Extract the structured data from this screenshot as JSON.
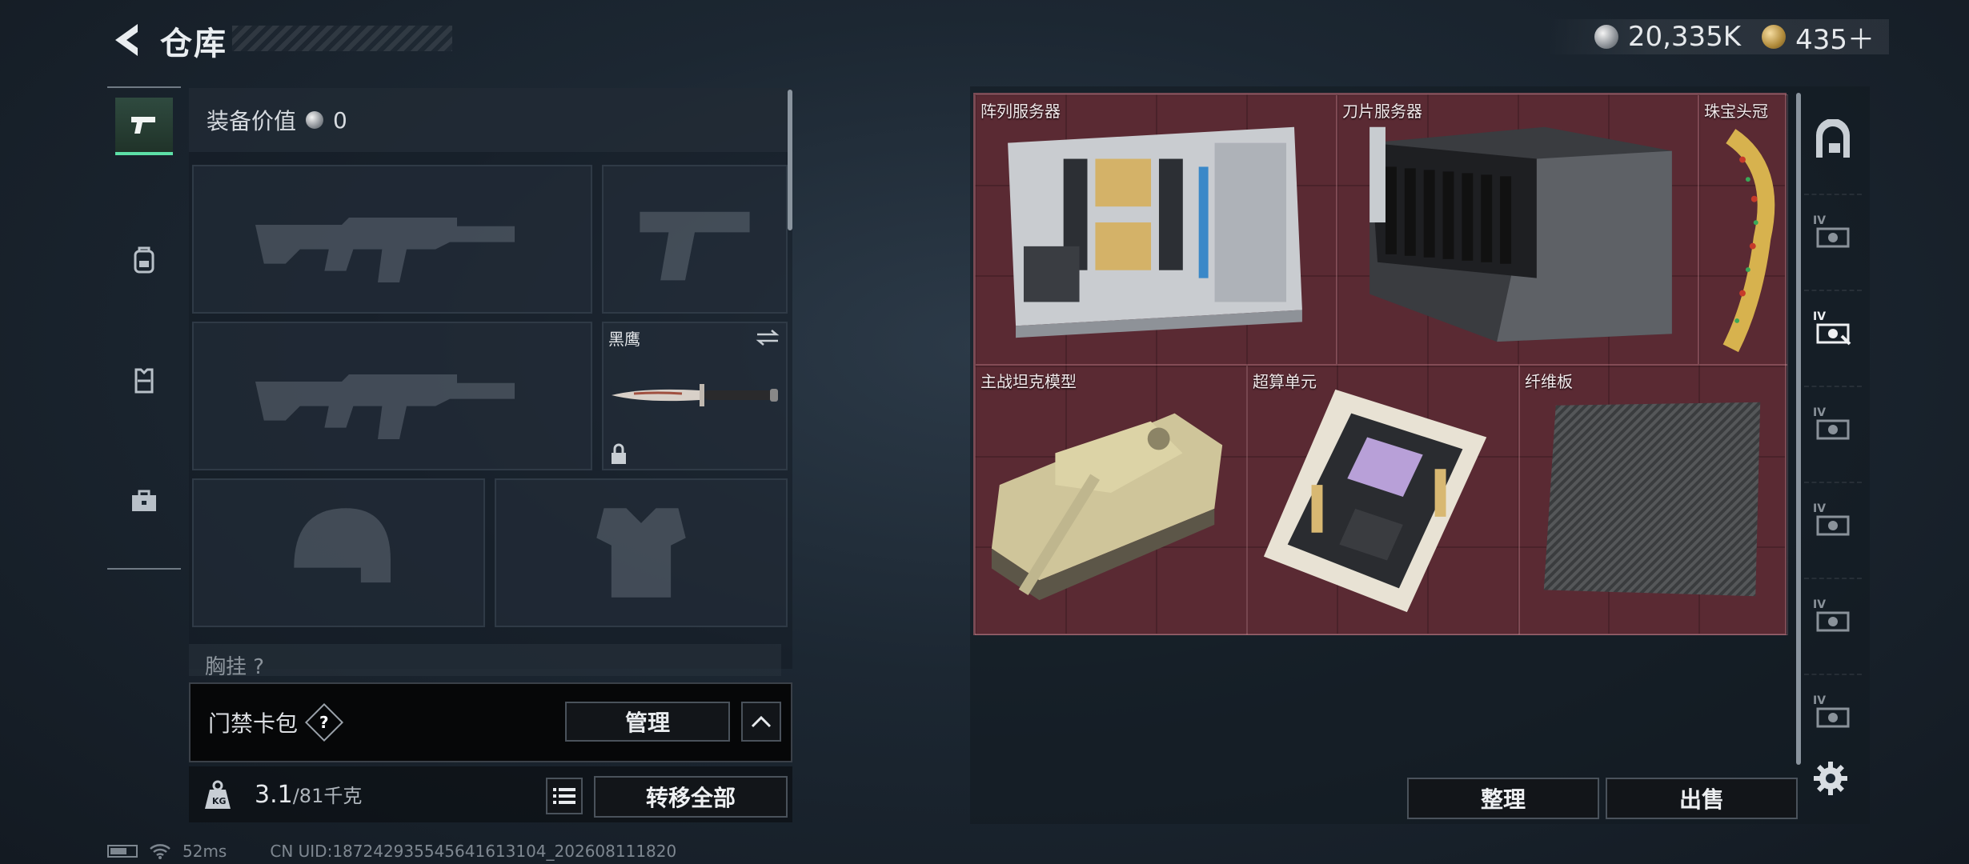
{
  "header": {
    "title": "仓库",
    "currency": {
      "silver": "20,335K",
      "gold": "435＋"
    }
  },
  "left_tabs": [
    "pistol-icon",
    "backpack-icon",
    "vest-icon",
    "toolbox-icon"
  ],
  "equip": {
    "value_label": "装备价值",
    "value": "0",
    "knife_name": "黑鹰",
    "chest_label": "胸挂",
    "chest_help": "?"
  },
  "card_bar": {
    "label": "门禁卡包",
    "help": "?",
    "manage": "管理"
  },
  "weight": {
    "current": "3.1",
    "max": "/81千克",
    "transfer_all": "转移全部"
  },
  "storage": {
    "items": [
      {
        "name": "阵列服务器"
      },
      {
        "name": "刀片服务器"
      },
      {
        "name": "珠宝头冠"
      },
      {
        "name": "主战坦克模型"
      },
      {
        "name": "超算单元"
      },
      {
        "name": "纤维板"
      }
    ],
    "sort": "整理",
    "sell": "出售"
  },
  "status": {
    "ping": "52ms",
    "uid": "CN UID:18724293554564161310​4_202608111820"
  },
  "colors": {
    "accent": "#5de0a8",
    "storage_bg": "#5a2a33"
  }
}
